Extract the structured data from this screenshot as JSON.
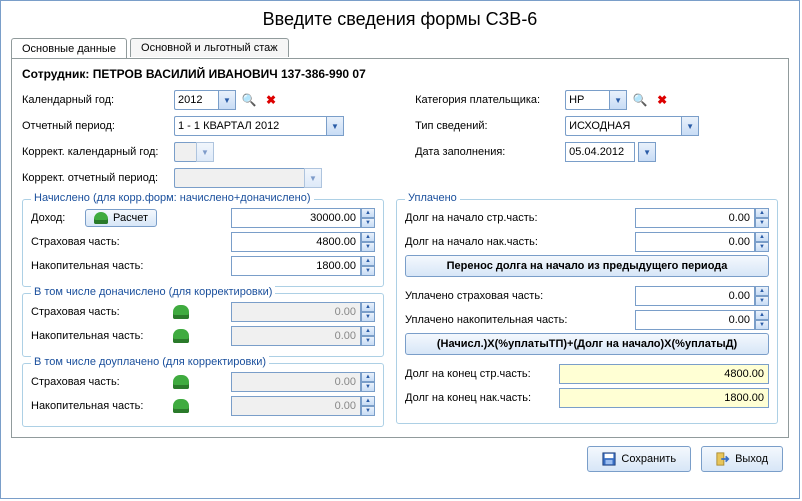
{
  "title": "Введите сведения формы СЗВ-6",
  "tabs": {
    "main": "Основные данные",
    "stazh": "Основной и льготный стаж"
  },
  "employee_label": "Сотрудник:",
  "employee_value": "ПЕТРОВ ВАСИЛИЙ ИВАНОВИЧ 137-386-990 07",
  "upper": {
    "year_label": "Календарный год:",
    "year_value": "2012",
    "period_label": "Отчетный период:",
    "period_value": "1 - 1 КВАРТАЛ 2012",
    "korr_year_label": "Коррект. календарный год:",
    "korr_year_value": "",
    "korr_period_label": "Коррект. отчетный период:",
    "korr_period_value": "",
    "cat_label": "Категория плательщика:",
    "cat_value": "НР",
    "type_label": "Тип сведений:",
    "type_value": "ИСХОДНАЯ",
    "date_label": "Дата заполнения:",
    "date_value": "05.04.2012"
  },
  "nachisleno": {
    "legend": "Начислено (для корр.форм: начислено+доначислено)",
    "dohod_label": "Доход:",
    "calc_label": "Расчет",
    "dohod_value": "30000.00",
    "strah_label": "Страховая часть:",
    "strah_value": "4800.00",
    "nak_label": "Накопительная часть:",
    "nak_value": "1800.00"
  },
  "donachisleno": {
    "legend": "В том числе доначислено (для корректировки)",
    "strah_label": "Страховая часть:",
    "strah_value": "0.00",
    "nak_label": "Накопительная часть:",
    "nak_value": "0.00"
  },
  "douplacheno": {
    "legend": "В том числе доуплачено (для корректировки)",
    "strah_label": "Страховая часть:",
    "strah_value": "0.00",
    "nak_label": "Накопительная часть:",
    "nak_value": "0.00"
  },
  "uplacheno": {
    "legend": "Уплачено",
    "dolg_start_strah_label": "Долг на начало стр.часть:",
    "dolg_start_strah_value": "0.00",
    "dolg_start_nak_label": "Долг на начало нак.часть:",
    "dolg_start_nak_value": "0.00",
    "transfer_btn": "Перенос долга на начало из предыдущего периода",
    "upl_strah_label": "Уплачено страховая часть:",
    "upl_strah_value": "0.00",
    "upl_nak_label": "Уплачено накопительная часть:",
    "upl_nak_value": "0.00",
    "formula_btn": "(Начисл.)X(%уплатыТП)+(Долг на начало)X(%уплатыД)",
    "dolg_end_strah_label": "Долг на конец стр.часть:",
    "dolg_end_strah_value": "4800.00",
    "dolg_end_nak_label": "Долг на конец нак.часть:",
    "dolg_end_nak_value": "1800.00"
  },
  "buttons": {
    "save": "Сохранить",
    "exit": "Выход"
  }
}
